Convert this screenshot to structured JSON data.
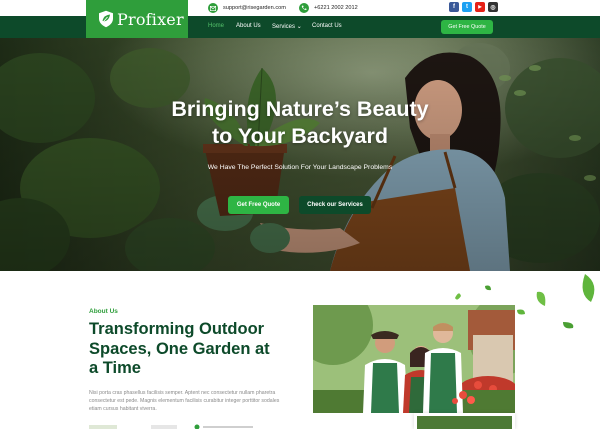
{
  "brand": {
    "name": "Profixer"
  },
  "topbar": {
    "email": "support@risegarden.com",
    "phone": "+6221 2002 2012",
    "socials": [
      {
        "name": "facebook-icon",
        "glyph": "f",
        "color": "#3b5998"
      },
      {
        "name": "twitter-icon",
        "glyph": "t",
        "color": "#1da1f2"
      },
      {
        "name": "youtube-icon",
        "glyph": "▶",
        "color": "#e62117"
      },
      {
        "name": "instagram-icon",
        "glyph": "◎",
        "color": "#333333"
      }
    ]
  },
  "nav": {
    "items": [
      "Home",
      "About Us",
      "Services",
      "Contact Us"
    ],
    "services_caret": "⌄",
    "cta": "Get Free Quote"
  },
  "hero": {
    "title_line1": "Bringing Nature’s Beauty",
    "title_line2": "to Your Backyard",
    "subtitle": "We Have The Perfect Solution For Your Landscape Problems",
    "btn_primary": "Get Free Quote",
    "btn_secondary": "Check our Services"
  },
  "about": {
    "label": "About Us",
    "title_line1": "Transforming Outdoor",
    "title_line2": "Spaces, One Garden at",
    "title_line3": "a Time",
    "text": "Nisi porta cras phasellus facilisis semper. Aptent nec consectetur nullam pharetra consectetur est pede. Magnis elementum facilisis curabitur integer porttitor sodales etiam cursus habitant viverra."
  },
  "colors": {
    "brand_green": "#2f9e3b",
    "dark_green": "#0d4a2a",
    "button_green": "#2eb544",
    "active_nav": "#54c26b"
  }
}
